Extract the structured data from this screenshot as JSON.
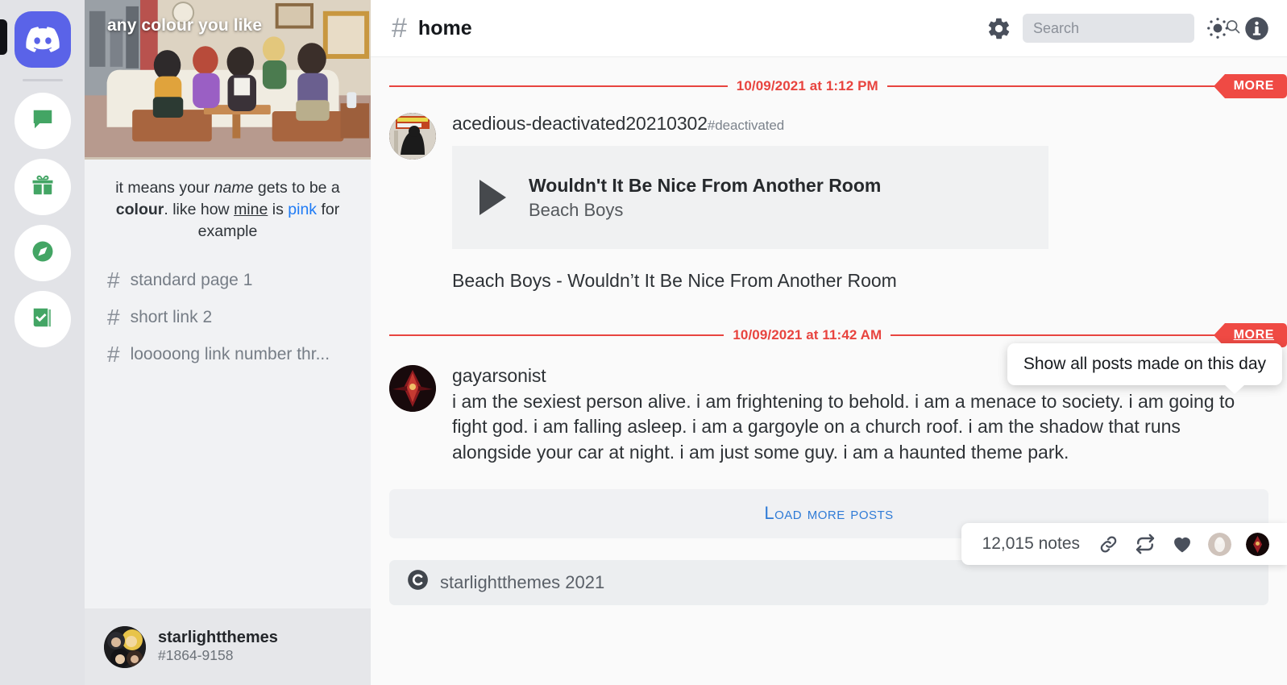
{
  "rail": {
    "logo": {
      "name": "discord-logo",
      "color": "#5a63e8"
    },
    "items": [
      {
        "icon": "chat-bubble-icon",
        "label": "Messages"
      },
      {
        "icon": "gift-icon",
        "label": "Gifts"
      },
      {
        "icon": "compass-icon",
        "label": "Explore"
      },
      {
        "icon": "book-check-icon",
        "label": "Tasks"
      }
    ]
  },
  "sidebar": {
    "banner_title": "any colour you like",
    "description": {
      "part1": "it means your ",
      "italic": "name",
      "part2": " gets to be a ",
      "bold": "colour",
      "part3": ". like how ",
      "underline": "mine",
      "part4": " is ",
      "link": "pink",
      "part5": " for example"
    },
    "channels": [
      {
        "hash": "#",
        "label": "standard page 1"
      },
      {
        "hash": "#",
        "label": "short link 2"
      },
      {
        "hash": "#",
        "label": "looooong link number thr..."
      }
    ],
    "user": {
      "name": "starlightthemes",
      "tag": "#1864-9158"
    }
  },
  "topbar": {
    "hash": "#",
    "title": "home",
    "gear_label": "Settings",
    "search_placeholder": "Search",
    "search_value": "",
    "sun_label": "Theme",
    "info_label": "Info"
  },
  "feed": {
    "posts": [
      {
        "date": "10/09/2021 at 1:12 PM",
        "more_label": "MORE",
        "author": "acedious-deactivated20210302",
        "author_suffix": "#deactivated",
        "audio": {
          "title": "Wouldn't It Be Nice From Another Room",
          "artist": "Beach Boys"
        },
        "caption": "Beach Boys - Wouldn’t It Be Nice From Another Room"
      },
      {
        "date": "10/09/2021 at 11:42 AM",
        "more_label": "MORE",
        "author": "gayarsonist",
        "text": "i am the sexiest person alive. i am frightening to behold. i am a menace to society. i am going to fight god. i am falling asleep. i am a gargoyle on a church roof. i am the shadow that runs alongside your car at night. i am just some guy. i am a haunted theme park."
      }
    ],
    "notes": {
      "count": "12,015 notes",
      "link_icon": "link-icon",
      "reblog_icon": "reblog-icon",
      "like_icon": "heart-icon"
    },
    "tooltip": "Show all posts made on this day",
    "load_more": "Load more posts",
    "credit": "starlightthemes 2021"
  },
  "colors": {
    "accent_red": "#ef4a44",
    "link_blue": "#2f7bd6",
    "rail_bg": "#e2e3e7",
    "sidebar_bg": "#f1f2f4",
    "main_bg": "#fafafa",
    "icon_green": "#3aa濃"
  }
}
